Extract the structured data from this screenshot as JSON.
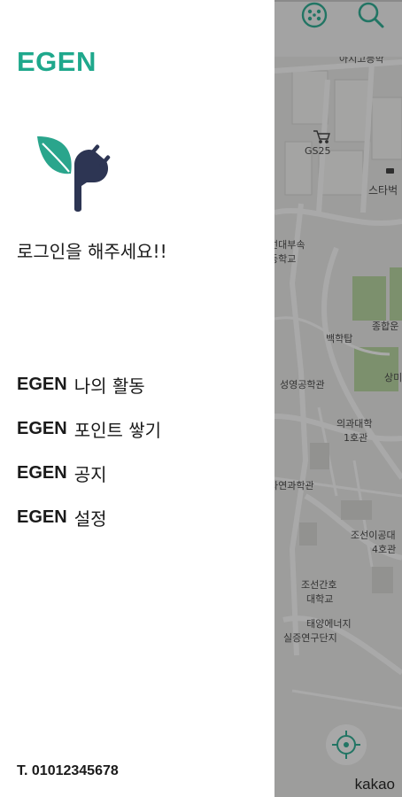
{
  "drawer": {
    "brand": "EGEN",
    "login_prompt": "로그인을 해주세요!!",
    "menu": [
      {
        "brand": "EGEN",
        "label": "나의 활동"
      },
      {
        "brand": "EGEN",
        "label": "포인트 쌓기"
      },
      {
        "brand": "EGEN",
        "label": "공지"
      },
      {
        "brand": "EGEN",
        "label": "설정"
      }
    ],
    "phone": "T. 01012345678"
  },
  "map": {
    "attribution": "kakao",
    "labels": {
      "top_cut": "아지고등학",
      "gs25": "GS25",
      "starbucks": "스타벅",
      "school1": "선대부속",
      "school2": "등학교",
      "baekhak": "백학탑",
      "jonghap": "종합운",
      "seongyeong": "성영공학관",
      "medical1": "의과대학",
      "medical2": "1호관",
      "sangmi": "상미관",
      "nature": "자연과학관",
      "joseon1": "조선이공대",
      "joseon2": "4호관",
      "nursing1": "조선간호",
      "nursing2": "대학교",
      "solar1": "태양에너지",
      "solar2": "실증연구단지"
    }
  },
  "colors": {
    "brand_green": "#1fa88c",
    "logo_navy": "#2d3553",
    "leaf_teal": "#2aa58c"
  },
  "icons": [
    "ev-charger-icon",
    "search-icon",
    "gps-locate-icon",
    "gs25-store-icon",
    "cafe-icon"
  ]
}
